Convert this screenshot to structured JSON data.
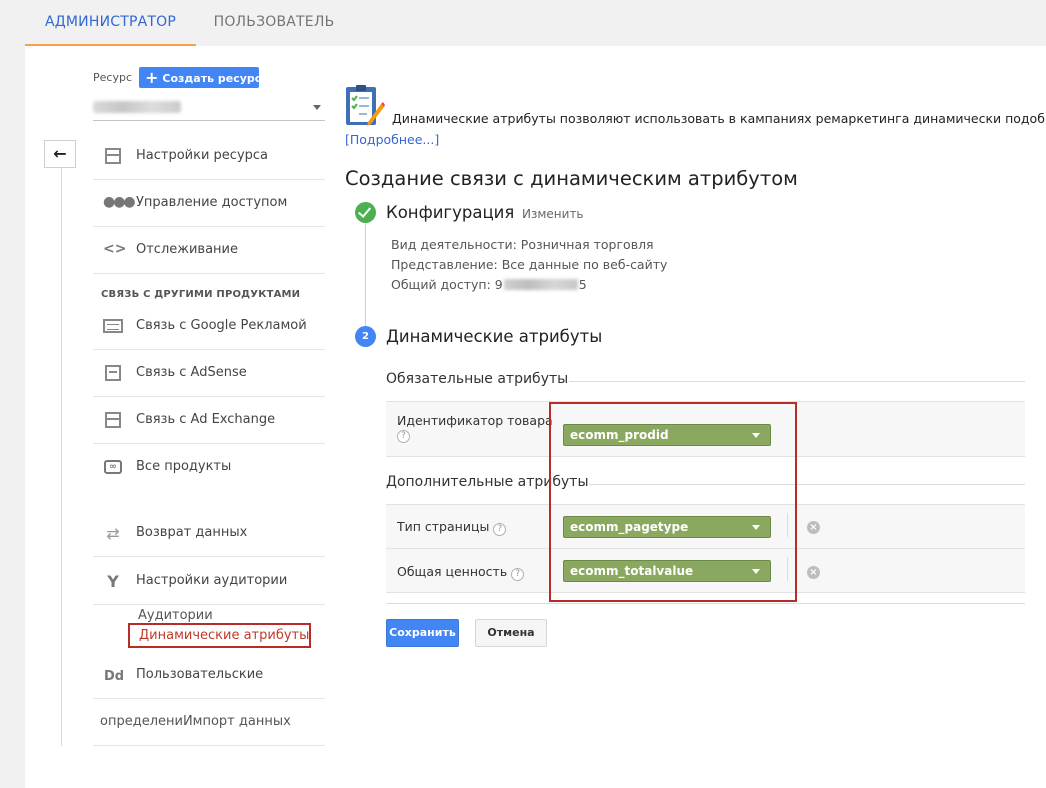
{
  "tabs": {
    "admin": "АДМИНИСТРАТОР",
    "user": "ПОЛЬЗОВАТЕЛЬ"
  },
  "sidebar": {
    "resource_label": "Ресурс",
    "create_button": "Создать ресурс",
    "back_symbol": "←",
    "section_heading": "СВЯЗЬ С ДРУГИМИ ПРОДУКТАМИ",
    "items": {
      "resource_settings": "Настройки ресурса",
      "access": "Управление доступом",
      "tracking": "Отслеживание",
      "google_ads": "Связь с Google Рекламой",
      "adsense": "Связь с AdSense",
      "ad_exchange": "Связь с Ad Exchange",
      "all_products": "Все продукты",
      "data_return": "Возврат данных",
      "audience_settings": "Настройки аудитории",
      "audiences": "Аудитории",
      "dynamic_attributes": "Динамические атрибуты",
      "custom": "Пользовательские",
      "dd_icon": "Dd",
      "overlap_text": "определениИмпорт данных"
    }
  },
  "main": {
    "info_text": "Динамические атрибуты позволяют использовать в кампаниях ремаркетинга динамически подобранны",
    "more_link": "[Подробнее...]",
    "title": "Создание связи с динамическим атрибутом",
    "step1": {
      "title": "Конфигурация",
      "edit": "Изменить",
      "business_type": "Вид деятельности: Розничная торговля",
      "view": "Представление: Все данные по веб-сайту",
      "sharing_prefix": "Общий доступ: 9",
      "sharing_suffix": "5"
    },
    "step2": {
      "number": "2",
      "title": "Динамические атрибуты",
      "required_heading": "Обязательные атрибуты",
      "optional_heading": "Дополнительные атрибуты",
      "help": "?",
      "remove": "×",
      "rows": {
        "product_id": {
          "label": "Идентификатор товара",
          "value": "ecomm_prodid"
        },
        "page_type": {
          "label": "Тип страницы",
          "value": "ecomm_pagetype"
        },
        "total_value": {
          "label": "Общая ценность",
          "value": "ecomm_totalvalue"
        }
      }
    },
    "save_button": "Сохранить",
    "cancel_button": "Отмена"
  }
}
